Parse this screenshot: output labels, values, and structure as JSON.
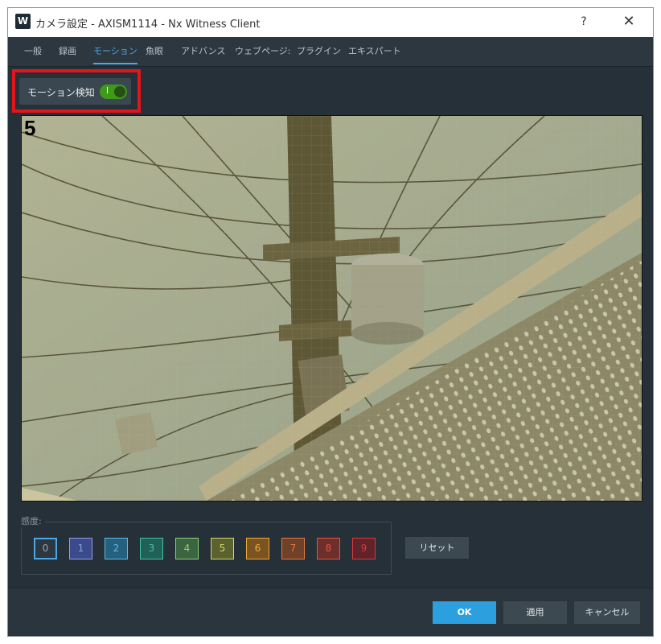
{
  "window": {
    "title": "カメラ設定 - AXISM1114 - Nx Witness Client",
    "app_icon_letter": "W",
    "help_label": "?",
    "close_label": "✕"
  },
  "tabs": [
    {
      "label": "一般",
      "active": false
    },
    {
      "label": "録画",
      "active": false
    },
    {
      "label": "モーション",
      "active": true
    },
    {
      "label": "魚眼",
      "active": false
    },
    {
      "label": "アドバンス",
      "active": false
    },
    {
      "label": "ウェブページ:",
      "active": false
    },
    {
      "label": "プラグイン",
      "active": false
    },
    {
      "label": "エキスパート",
      "active": false
    }
  ],
  "motion_detection": {
    "label": "モーション検知",
    "enabled": true,
    "toggle_color": "#3d9a1b",
    "highlight_color": "#e3141a"
  },
  "video": {
    "channel_number": "5"
  },
  "sensitivity": {
    "label": "感度:",
    "selected": 0,
    "levels": [
      {
        "label": "0",
        "color": "#2c3740",
        "text_color": "#9aa4ad"
      },
      {
        "label": "1",
        "color": "#3b4a8a",
        "text_color": "#8ea0e0"
      },
      {
        "label": "2",
        "color": "#26607f",
        "text_color": "#5fb9ea"
      },
      {
        "label": "3",
        "color": "#216056",
        "text_color": "#45c2a8"
      },
      {
        "label": "4",
        "color": "#3b6440",
        "text_color": "#8fd07a"
      },
      {
        "label": "5",
        "color": "#5b6230",
        "text_color": "#d4d76a"
      },
      {
        "label": "6",
        "color": "#7a5420",
        "text_color": "#f0a83a"
      },
      {
        "label": "7",
        "color": "#6e4128",
        "text_color": "#e27a3f"
      },
      {
        "label": "8",
        "color": "#6d2f2c",
        "text_color": "#e7533f"
      },
      {
        "label": "9",
        "color": "#5e242a",
        "text_color": "#d63a3e"
      }
    ],
    "reset_label": "リセット"
  },
  "buttons": {
    "ok": "OK",
    "apply": "適用",
    "cancel": "キャンセル"
  }
}
